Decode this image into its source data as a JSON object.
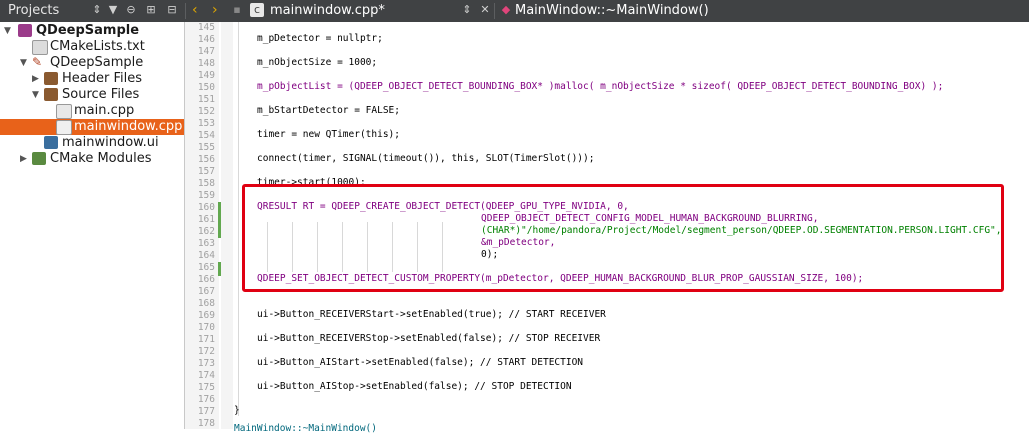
{
  "toolbar": {
    "projects_title": "Projects",
    "file_tab": "mainwindow.cpp*",
    "symbol": "MainWindow::~MainWindow()"
  },
  "tree": [
    {
      "label": "QDeepSample",
      "bold": true
    },
    {
      "label": "CMakeLists.txt"
    },
    {
      "label": "QDeepSample"
    },
    {
      "label": "Header Files"
    },
    {
      "label": "Source Files"
    },
    {
      "label": "main.cpp"
    },
    {
      "label": "mainwindow.cpp",
      "selected": true
    },
    {
      "label": "mainwindow.ui"
    },
    {
      "label": "CMake Modules"
    }
  ],
  "line_numbers": [
    "145",
    "146",
    "147",
    "148",
    "149",
    "150",
    "151",
    "152",
    "153",
    "154",
    "155",
    "156",
    "157",
    "158",
    "159",
    "160",
    "161",
    "162",
    "163",
    "164",
    "165",
    "166",
    "167",
    "168",
    "169",
    "170",
    "171",
    "172",
    "173",
    "174",
    "175",
    "176",
    "177",
    "178",
    "179"
  ],
  "code": {
    "l146": "m_pDetector = nullptr;",
    "l148": "m_nObjectSize = 1000;",
    "l150a": "m_pObjectList = (QDEEP_OBJECT_DETECT_BOUNDING_BOX* )malloc( m_nObjectSize * sizeof( QDEEP_OBJECT_DETECT_BOUNDING_BOX) );",
    "l152": "m_bStartDetector = FALSE;",
    "l154": "timer = new QTimer(this);",
    "l156": "connect(timer, SIGNAL(timeout()), this, SLOT(TimerSlot()));",
    "l158": "timer->start(1000);",
    "l160": "QRESULT RT = QDEEP_CREATE_OBJECT_DETECT(QDEEP_GPU_TYPE_NVIDIA, 0,",
    "l161": "QDEEP_OBJECT_DETECT_CONFIG_MODEL_HUMAN_BACKGROUND_BLURRING,",
    "l162": "(CHAR*)\"/home/pandora/Project/Model/segment_person/QDEEP.OD.SEGMENTATION.PERSON.LIGHT.CFG\",",
    "l163": "&m_pDetector,",
    "l164": "0);",
    "l166": "QDEEP_SET_OBJECT_DETECT_CUSTOM_PROPERTY(m_pDetector, QDEEP_HUMAN_BACKGROUND_BLUR_PROP_GAUSSIAN_SIZE, 100);",
    "l168": "ui->Button_RECEIVERStart->setEnabled(true); // START RECEIVER",
    "l170": "ui->Button_RECEIVERStop->setEnabled(false); // STOP RECEIVER",
    "l172": "ui->Button_AIStart->setEnabled(false); // START DETECTION",
    "l174": "ui->Button_AIStop->setEnabled(false); // STOP DETECTION",
    "l177": "}",
    "l179": "MainWindow::~MainWindow()"
  },
  "colors": {
    "selection": "#e8621a",
    "highlight_box": "#e00012",
    "change_bar": "#62a84f"
  }
}
